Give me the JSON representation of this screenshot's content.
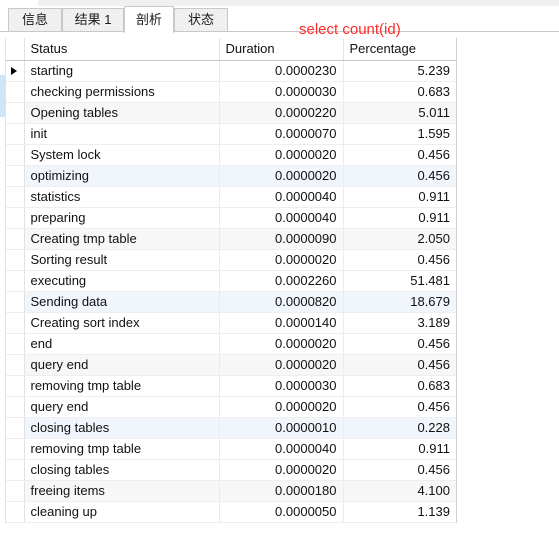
{
  "tabs": [
    {
      "label": "信息",
      "active": false
    },
    {
      "label": "结果 1",
      "active": false
    },
    {
      "label": "剖析",
      "active": true
    },
    {
      "label": "状态",
      "active": false
    }
  ],
  "annotation": {
    "text": "select count(id)",
    "color": "#ff2b2b"
  },
  "table": {
    "columns": [
      "Status",
      "Duration",
      "Percentage"
    ],
    "rows": [
      {
        "status": "starting",
        "duration": "0.0000230",
        "percentage": "5.239",
        "marker": true,
        "shade": "none"
      },
      {
        "status": "checking permissions",
        "duration": "0.0000030",
        "percentage": "0.683",
        "marker": false,
        "shade": "none"
      },
      {
        "status": "Opening tables",
        "duration": "0.0000220",
        "percentage": "5.011",
        "marker": false,
        "shade": "gray"
      },
      {
        "status": "init",
        "duration": "0.0000070",
        "percentage": "1.595",
        "marker": false,
        "shade": "none"
      },
      {
        "status": "System lock",
        "duration": "0.0000020",
        "percentage": "0.456",
        "marker": false,
        "shade": "none"
      },
      {
        "status": "optimizing",
        "duration": "0.0000020",
        "percentage": "0.456",
        "marker": false,
        "shade": "blue"
      },
      {
        "status": "statistics",
        "duration": "0.0000040",
        "percentage": "0.911",
        "marker": false,
        "shade": "none"
      },
      {
        "status": "preparing",
        "duration": "0.0000040",
        "percentage": "0.911",
        "marker": false,
        "shade": "none"
      },
      {
        "status": "Creating tmp table",
        "duration": "0.0000090",
        "percentage": "2.050",
        "marker": false,
        "shade": "gray"
      },
      {
        "status": "Sorting result",
        "duration": "0.0000020",
        "percentage": "0.456",
        "marker": false,
        "shade": "none"
      },
      {
        "status": "executing",
        "duration": "0.0002260",
        "percentage": "51.481",
        "marker": false,
        "shade": "none"
      },
      {
        "status": "Sending data",
        "duration": "0.0000820",
        "percentage": "18.679",
        "marker": false,
        "shade": "blue"
      },
      {
        "status": "Creating sort index",
        "duration": "0.0000140",
        "percentage": "3.189",
        "marker": false,
        "shade": "none"
      },
      {
        "status": "end",
        "duration": "0.0000020",
        "percentage": "0.456",
        "marker": false,
        "shade": "none"
      },
      {
        "status": "query end",
        "duration": "0.0000020",
        "percentage": "0.456",
        "marker": false,
        "shade": "gray"
      },
      {
        "status": "removing tmp table",
        "duration": "0.0000030",
        "percentage": "0.683",
        "marker": false,
        "shade": "none"
      },
      {
        "status": "query end",
        "duration": "0.0000020",
        "percentage": "0.456",
        "marker": false,
        "shade": "none"
      },
      {
        "status": "closing tables",
        "duration": "0.0000010",
        "percentage": "0.228",
        "marker": false,
        "shade": "blue"
      },
      {
        "status": "removing tmp table",
        "duration": "0.0000040",
        "percentage": "0.911",
        "marker": false,
        "shade": "none"
      },
      {
        "status": "closing tables",
        "duration": "0.0000020",
        "percentage": "0.456",
        "marker": false,
        "shade": "none"
      },
      {
        "status": "freeing items",
        "duration": "0.0000180",
        "percentage": "4.100",
        "marker": false,
        "shade": "gray"
      },
      {
        "status": "cleaning up",
        "duration": "0.0000050",
        "percentage": "1.139",
        "marker": false,
        "shade": "none"
      }
    ]
  }
}
